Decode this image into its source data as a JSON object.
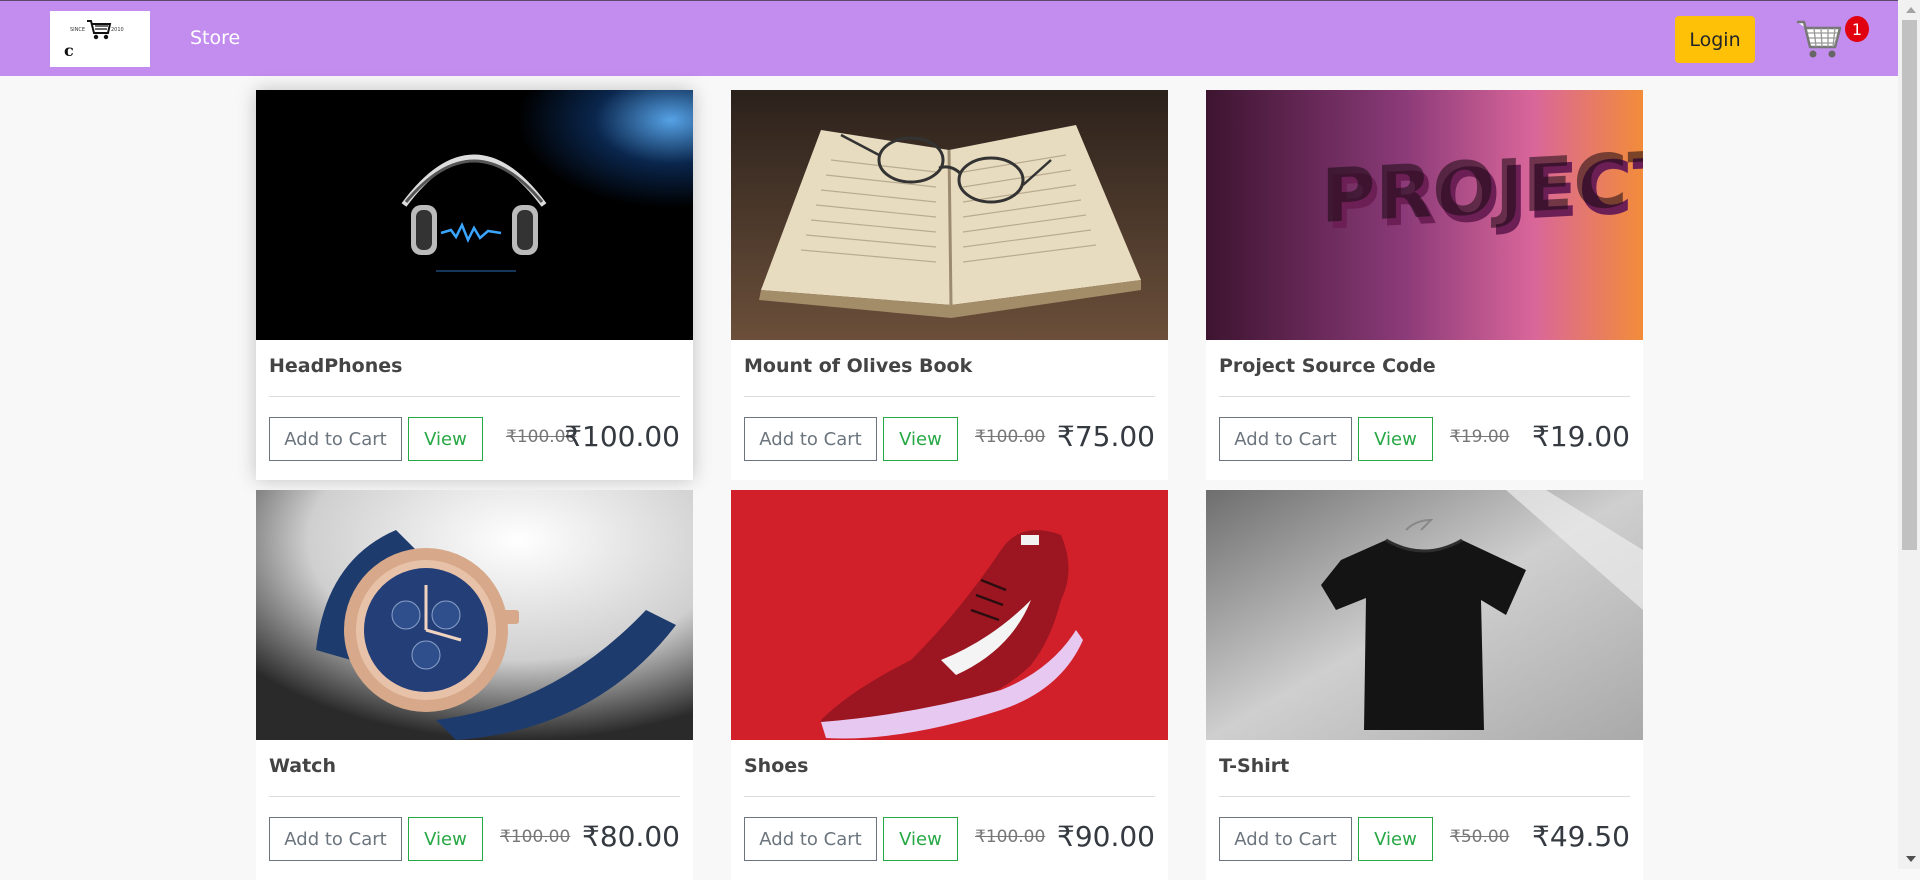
{
  "navbar": {
    "logo_since": "SINCE",
    "logo_year": "2010",
    "logo_letter": "c",
    "store_link": "Store",
    "login_label": "Login",
    "cart_count": "1",
    "bg_color": "#c38cef"
  },
  "products": [
    {
      "title": "HeadPhones",
      "add_label": "Add to Cart",
      "view_label": "View",
      "old_price": "₹100.00",
      "price": "₹100.00",
      "image": "headphones-image"
    },
    {
      "title": "Mount of Olives Book",
      "add_label": "Add to Cart",
      "view_label": "View",
      "old_price": "₹100.00",
      "price": "₹75.00",
      "image": "book-glasses-image"
    },
    {
      "title": "Project Source Code",
      "add_label": "Add to Cart",
      "view_label": "View",
      "old_price": "₹19.00",
      "price": "₹19.00",
      "image": "projects-image"
    },
    {
      "title": "Watch",
      "add_label": "Add to Cart",
      "view_label": "View",
      "old_price": "₹100.00",
      "price": "₹80.00",
      "image": "watch-image"
    },
    {
      "title": "Shoes",
      "add_label": "Add to Cart",
      "view_label": "View",
      "old_price": "₹100.00",
      "price": "₹90.00",
      "image": "shoe-image"
    },
    {
      "title": "T-Shirt",
      "add_label": "Add to Cart",
      "view_label": "View",
      "old_price": "₹50.00",
      "price": "₹49.50",
      "image": "tshirt-image"
    }
  ],
  "projects_image_text": "PROJECTS"
}
